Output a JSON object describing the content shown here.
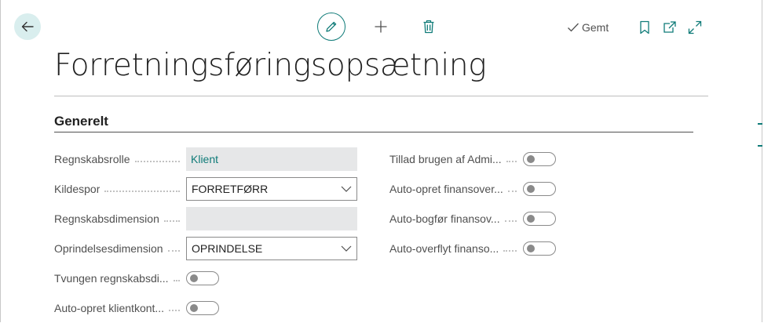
{
  "toolbar": {
    "saved_label": "Gemt"
  },
  "page": {
    "title": "Forretningsføringsopsætning"
  },
  "section": {
    "title": "Generelt"
  },
  "left_fields": [
    {
      "label": "Regnskabsrolle",
      "kind": "readonly",
      "value": "Klient"
    },
    {
      "label": "Kildespor",
      "kind": "select",
      "value": "FORRETFØRR"
    },
    {
      "label": "Regnskabsdimension",
      "kind": "readonly",
      "value": ""
    },
    {
      "label": "Oprindelsesdimension",
      "kind": "select",
      "value": "OPRINDELSE"
    },
    {
      "label": "Tvungen regnskabsdi...",
      "kind": "toggle",
      "value": "off"
    },
    {
      "label": "Auto-opret klientkont...",
      "kind": "toggle",
      "value": "off"
    }
  ],
  "right_fields": [
    {
      "label": "Tillad brugen af Admi...",
      "kind": "toggle",
      "value": "off"
    },
    {
      "label": "Auto-opret finansover...",
      "kind": "toggle",
      "value": "off"
    },
    {
      "label": "Auto-bogfør finansov...",
      "kind": "toggle",
      "value": "off"
    },
    {
      "label": "Auto-overflyt finanso...",
      "kind": "toggle",
      "value": "off"
    }
  ],
  "colors": {
    "accent": "#0f7b78",
    "readonly_bg": "#e6e7e8",
    "label": "#505050"
  }
}
